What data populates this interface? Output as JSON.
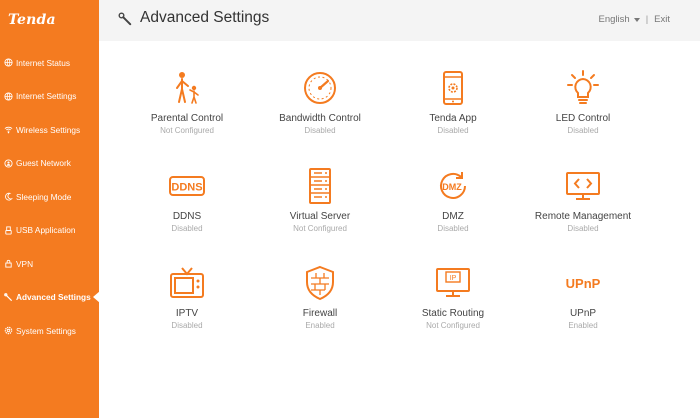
{
  "brand": {
    "logo": "Tenda",
    "accent": "#f47b20"
  },
  "sidebar": {
    "items": [
      {
        "label": "Internet Status",
        "icon": "globe-icon"
      },
      {
        "label": "Internet Settings",
        "icon": "globe-icon"
      },
      {
        "label": "Wireless Settings",
        "icon": "wifi-icon"
      },
      {
        "label": "Guest Network",
        "icon": "guest-icon"
      },
      {
        "label": "Sleeping Mode",
        "icon": "moon-icon"
      },
      {
        "label": "USB Application",
        "icon": "usb-icon"
      },
      {
        "label": "VPN",
        "icon": "vpn-icon"
      },
      {
        "label": "Advanced Settings",
        "icon": "wrench-icon",
        "active": true
      },
      {
        "label": "System Settings",
        "icon": "gear-icon"
      }
    ]
  },
  "header": {
    "title": "Advanced Settings",
    "language": "English",
    "separator": "|",
    "exit": "Exit"
  },
  "tiles": [
    {
      "name": "Parental Control",
      "status": "Not Configured",
      "icon": "parent-child-icon"
    },
    {
      "name": "Bandwidth Control",
      "status": "Disabled",
      "icon": "speedometer-icon"
    },
    {
      "name": "Tenda App",
      "status": "Disabled",
      "icon": "phone-app-icon"
    },
    {
      "name": "LED Control",
      "status": "Disabled",
      "icon": "bulb-icon"
    },
    {
      "name": "DDNS",
      "status": "Disabled",
      "icon": "ddns-icon"
    },
    {
      "name": "Virtual Server",
      "status": "Not Configured",
      "icon": "server-icon"
    },
    {
      "name": "DMZ",
      "status": "Disabled",
      "icon": "dmz-icon"
    },
    {
      "name": "Remote Management",
      "status": "Disabled",
      "icon": "monitor-code-icon"
    },
    {
      "name": "IPTV",
      "status": "Disabled",
      "icon": "tv-icon"
    },
    {
      "name": "Firewall",
      "status": "Enabled",
      "icon": "shield-icon"
    },
    {
      "name": "Static Routing",
      "status": "Not Configured",
      "icon": "ip-monitor-icon"
    },
    {
      "name": "UPnP",
      "status": "Enabled",
      "icon": "upnp-icon"
    }
  ]
}
